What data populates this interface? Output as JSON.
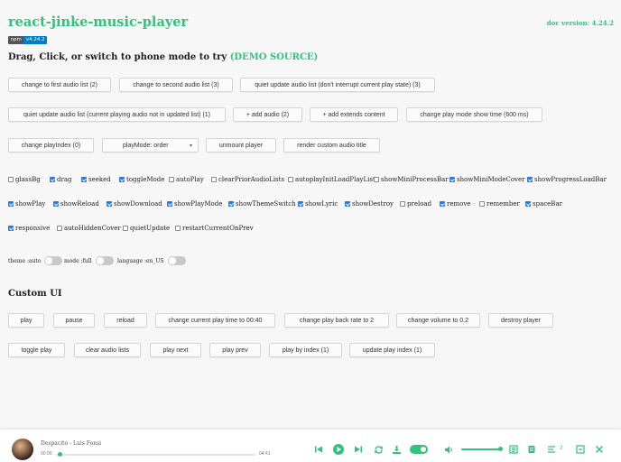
{
  "header": {
    "title": "react-jinke-music-player",
    "doc_version": "doc version: 4.24.2",
    "npm_label": "npm",
    "npm_version": "v4.24.2",
    "headline": "Drag, Click, or switch to phone mode to try",
    "demo_link": "(DEMO SOURCE)"
  },
  "buttons_top": [
    "change to first audio list (2)",
    "change to second audio list (3)",
    "quiet update audio list (don't interrupt current play state) (3)",
    "quiet update audio list (current playing audio not in updated list) (1)",
    "+ add audio (2)",
    "+ add extends content",
    "change play mode show time (600 ms)",
    "change playIndex (0)",
    "unmount player",
    "render custom audio title"
  ],
  "play_mode_select": {
    "value": "playMode: order"
  },
  "checkboxes": [
    {
      "label": "glassBg",
      "checked": false
    },
    {
      "label": "drag",
      "checked": true
    },
    {
      "label": "seeked",
      "checked": true
    },
    {
      "label": "toggleMode",
      "checked": true
    },
    {
      "label": "autoPlay",
      "checked": false
    },
    {
      "label": "clearPriorAudioLists",
      "checked": false
    },
    {
      "label": "autoplayInitLoadPlayList",
      "checked": false
    },
    {
      "label": "showMiniProcessBar",
      "checked": false
    },
    {
      "label": "showMiniModeCover",
      "checked": true
    },
    {
      "label": "showProgressLoadBar",
      "checked": true
    },
    {
      "label": "showPlay",
      "checked": true
    },
    {
      "label": "showReload",
      "checked": true
    },
    {
      "label": "showDownload",
      "checked": true
    },
    {
      "label": "showPlayMode",
      "checked": true
    },
    {
      "label": "showThemeSwitch",
      "checked": true
    },
    {
      "label": "showLyric",
      "checked": true
    },
    {
      "label": "showDestroy",
      "checked": true
    },
    {
      "label": "preload",
      "checked": false
    },
    {
      "label": "remove",
      "checked": true
    },
    {
      "label": "remember",
      "checked": false
    },
    {
      "label": "spaceBar",
      "checked": true
    },
    {
      "label": "responsive",
      "checked": true
    },
    {
      "label": "autoHiddenCover",
      "checked": false
    },
    {
      "label": "quietUpdate",
      "checked": false
    },
    {
      "label": "restartCurrentOnPrev",
      "checked": false
    }
  ],
  "switches": [
    {
      "label": "theme :auto",
      "state": "",
      "on": false
    },
    {
      "label": "mode :full",
      "state": "",
      "on": false
    },
    {
      "label": "language :en_US",
      "state": "",
      "on": false
    }
  ],
  "custom_ui": {
    "title": "Custom UI",
    "buttons": [
      "play",
      "pause",
      "reload",
      "change current play time to 00:40",
      "change play back rate to 2",
      "change volume to 0.2",
      "destroy player",
      "toggle play",
      "clear audio lists",
      "play next",
      "play prev",
      "play by index (1)",
      "update play index (1)"
    ]
  },
  "player": {
    "song": "Despacito - Luis Fonsi",
    "current_time": "00:00",
    "duration": "04:41",
    "progress": 0.0,
    "volume": 1.0,
    "playlist_count": "2",
    "accent_color": "#31c27c",
    "icons": [
      "prev-icon",
      "play-icon",
      "next-icon",
      "loop-icon",
      "download-icon",
      "theme-switch",
      "volume-icon",
      "lyric-icon",
      "reload-icon",
      "playlist-icon",
      "mini-mode-icon",
      "close-icon"
    ]
  }
}
